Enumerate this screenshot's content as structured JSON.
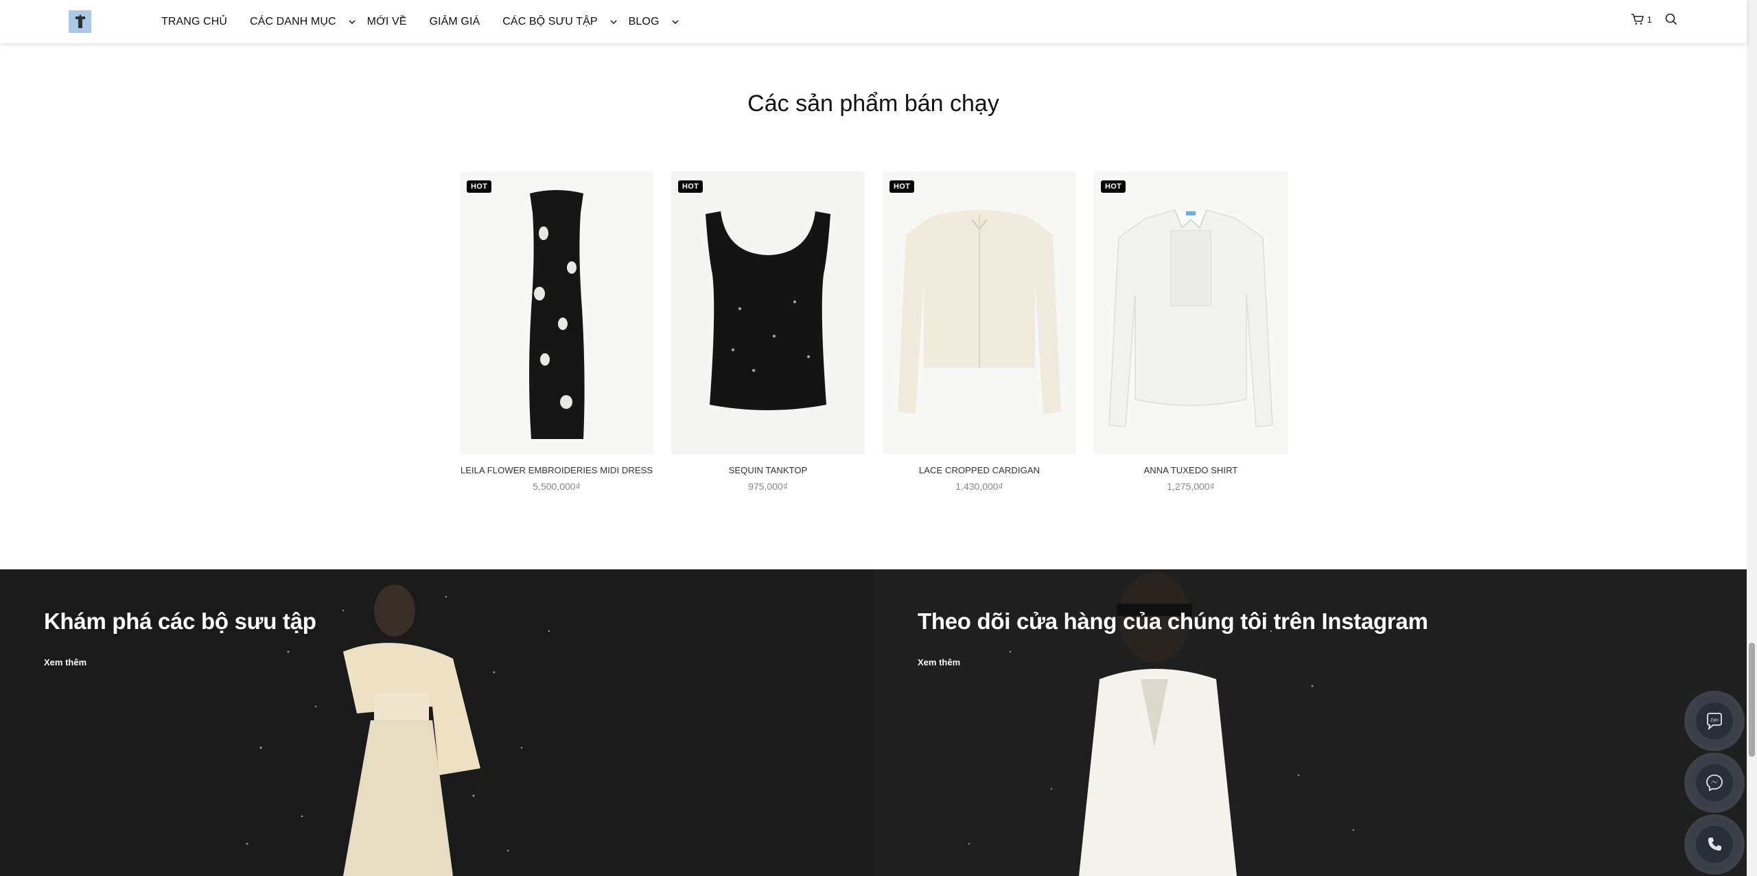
{
  "header": {
    "logo_alt": "store logo",
    "nav": [
      {
        "label": "TRANG CHỦ",
        "dropdown": false
      },
      {
        "label": "CÁC DANH MỤC",
        "dropdown": true
      },
      {
        "label": "MỚI VỀ",
        "dropdown": false
      },
      {
        "label": "GIẢM GIÁ",
        "dropdown": false
      },
      {
        "label": "CÁC BỘ SƯU TẬP",
        "dropdown": true
      },
      {
        "label": "BLOG",
        "dropdown": true
      }
    ],
    "cart_count": "1"
  },
  "best_sellers": {
    "title": "Các sản phẩm bán chạy",
    "products": [
      {
        "badge": "HOT",
        "name": "LEILA FLOWER EMBROIDERIES MIDI DRESS",
        "price": "5,500,000₫",
        "image": "black-strapless-midi-dress"
      },
      {
        "badge": "HOT",
        "name": "SEQUIN TANKTOP",
        "price": "975,000₫",
        "image": "black-sequin-tanktop"
      },
      {
        "badge": "HOT",
        "name": "LACE CROPPED CARDIGAN",
        "price": "1,430,000₫",
        "image": "cream-lace-cardigan"
      },
      {
        "badge": "HOT",
        "name": "ANNA TUXEDO SHIRT",
        "price": "1,275,000₫",
        "image": "white-tuxedo-shirt"
      }
    ]
  },
  "banners": {
    "left": {
      "title": "Khám phá các bộ sưu tập",
      "link": "Xem thêm"
    },
    "right": {
      "title": "Theo dõi cửa hàng của chúng tôi trên Instagram",
      "link": "Xem thêm"
    }
  },
  "floating_buttons": [
    {
      "name": "zalo",
      "label": "Zalo"
    },
    {
      "name": "messenger",
      "label": ""
    },
    {
      "name": "phone",
      "label": ""
    }
  ],
  "colors": {
    "badge_bg": "#000000",
    "price": "#888888",
    "banner_bg": "#1b1b1b",
    "logo_bg": "#a9c8e8"
  }
}
